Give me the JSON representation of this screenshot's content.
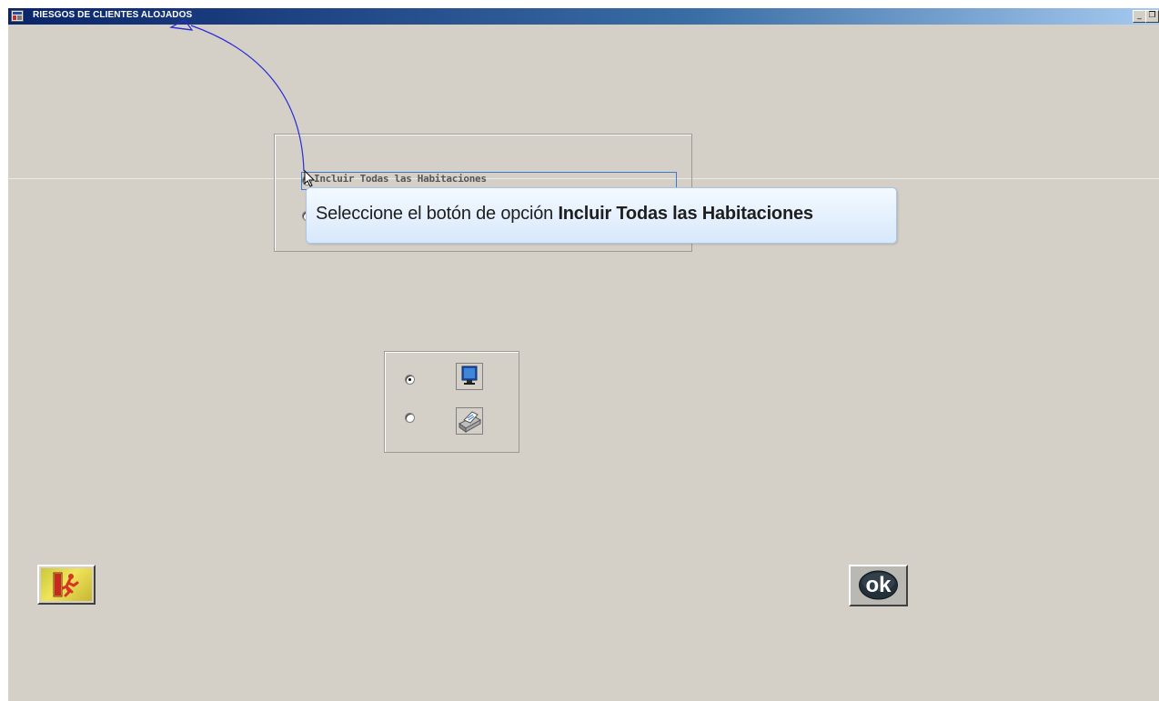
{
  "window": {
    "title": "RIESGOS DE CLIENTES ALOJADOS",
    "minimize_glyph": "_",
    "restore_glyph": "❐"
  },
  "room_options": {
    "include_all_label": "Incluir Todas las Habitaciones",
    "include_all_selected": true,
    "second_option_selected": false
  },
  "output_options": {
    "screen_icon": "monitor-icon",
    "printer_icon": "printer-icon",
    "screen_selected": true,
    "printer_selected": false
  },
  "buttons": {
    "exit_icon": "exit-door-running-man-icon",
    "ok_label": "ok"
  },
  "tooltip": {
    "prefix": "Seleccione el botón de opción",
    "target": "Incluir Todas las Habitaciones"
  },
  "colors": {
    "titlebar_start": "#0a246a",
    "titlebar_end": "#a6caf0",
    "window_bg": "#d4d0c8",
    "annotation_arrow": "#2b2bd6"
  }
}
